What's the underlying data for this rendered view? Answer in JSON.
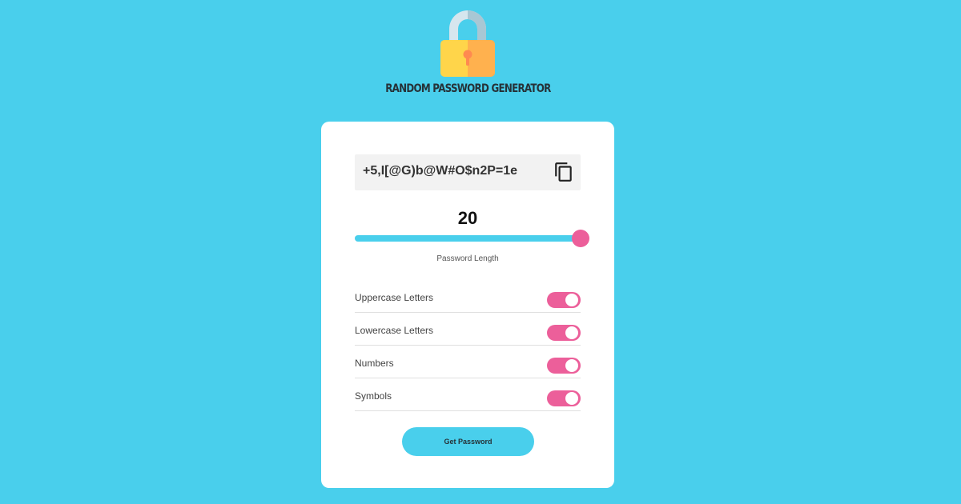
{
  "app": {
    "title": "RANDOM PASSWORD GENERATOR",
    "logo_icon": "padlock-icon"
  },
  "password": {
    "value": "+5,I[@G)b@W#O$n2P=1e",
    "copy_icon": "copy-icon"
  },
  "length": {
    "value": "20",
    "label": "Password Length",
    "slider_fraction": 1.0
  },
  "options": [
    {
      "label": "Uppercase Letters",
      "enabled": true
    },
    {
      "label": "Lowercase Letters",
      "enabled": true
    },
    {
      "label": "Numbers",
      "enabled": true
    },
    {
      "label": "Symbols",
      "enabled": true
    }
  ],
  "actions": {
    "generate_label": "Get Password"
  },
  "colors": {
    "background": "#49cfec",
    "accent": "#ec5f9a",
    "card": "#ffffff",
    "password_box": "#f2f2f2"
  }
}
